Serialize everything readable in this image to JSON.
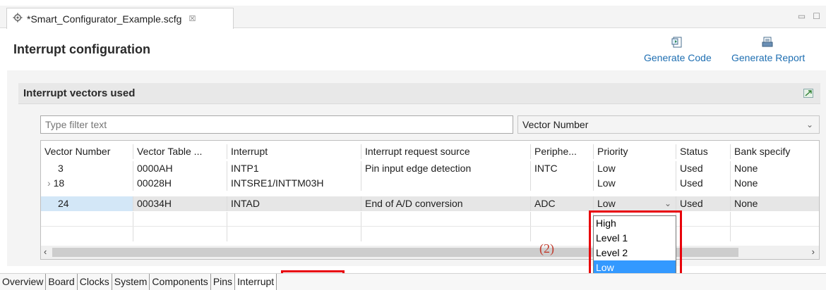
{
  "editor_tab": {
    "title": "*Smart_Configurator_Example.scfg",
    "close": "☒"
  },
  "window_controls": [
    "▭",
    "☐"
  ],
  "header": {
    "title": "Interrupt configuration"
  },
  "toolbar": {
    "generate_code": "Generate Code",
    "generate_report": "Generate Report"
  },
  "section": {
    "title": "Interrupt vectors used"
  },
  "filter": {
    "placeholder": "Type filter text"
  },
  "sort_select": {
    "value": "Vector Number"
  },
  "table": {
    "columns": [
      "Vector Number",
      "Vector Table ...",
      "Interrupt",
      "Interrupt request source",
      "Periphe...",
      "Priority",
      "Status",
      "Bank specify"
    ],
    "rows": [
      {
        "vector": "3",
        "table": "0000AH",
        "interrupt": "INTP1",
        "source": "Pin input edge detection",
        "peripheral": "INTC",
        "priority": "Low",
        "status": "Used",
        "bank": "None"
      },
      {
        "vector": "18",
        "table": "00028H",
        "interrupt": "INTSRE1/INTTM03H",
        "source": "",
        "peripheral": "",
        "priority": "Low",
        "status": "Used",
        "bank": "None"
      },
      {
        "vector": "24",
        "table": "00034H",
        "interrupt": "INTAD",
        "source": "End of A/D conversion",
        "peripheral": "ADC",
        "priority": "Low",
        "status": "Used",
        "bank": "None"
      }
    ]
  },
  "priority_dropdown": {
    "options": [
      "High",
      "Level 1",
      "Level 2",
      "Low"
    ],
    "selected": "Low"
  },
  "annotation": {
    "label": "(2)"
  },
  "bottom_tabs": [
    "Overview",
    "Board",
    "Clocks",
    "System",
    "Components",
    "Pins",
    "Interrupt"
  ],
  "colors": {
    "link": "#1f6fb2",
    "highlight": "#e8000b",
    "selection": "#3399ff"
  }
}
